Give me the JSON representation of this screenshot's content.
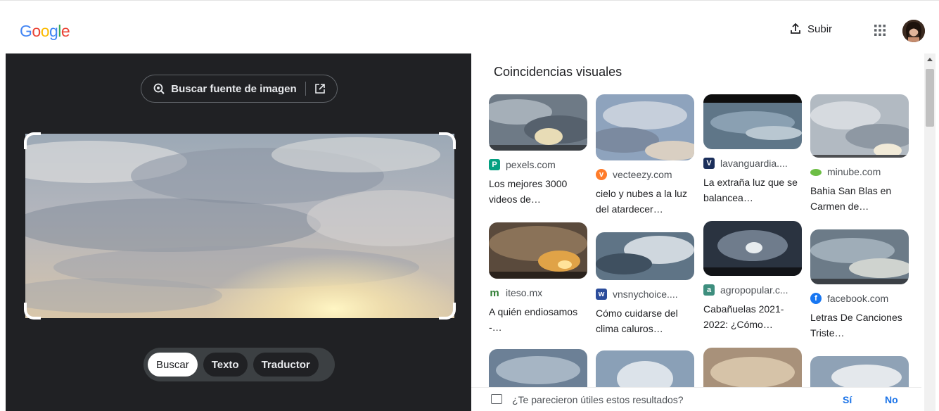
{
  "header": {
    "logo_letters": [
      "G",
      "o",
      "o",
      "g",
      "l",
      "e"
    ],
    "logo_colors": [
      "#4285F4",
      "#EA4335",
      "#FBBC05",
      "#4285F4",
      "#34A853",
      "#EA4335"
    ],
    "upload_label": "Subir",
    "upload_icon": "upload-icon",
    "apps_icon": "apps-grid-icon"
  },
  "left_panel": {
    "source_button_label": "Buscar fuente de imagen",
    "source_icon": "lens-search-icon",
    "open_icon": "open-in-new-icon",
    "modes": [
      {
        "label": "Buscar",
        "active": true
      },
      {
        "label": "Texto",
        "active": false
      },
      {
        "label": "Traductor",
        "active": false
      }
    ]
  },
  "results": {
    "title": "Coincidencias visuales",
    "cards": [
      {
        "site": "pexels.com",
        "favicon_letter": "P",
        "favicon_color": "#05A081",
        "title": "Los mejores 3000 videos de…"
      },
      {
        "site": "vecteezy.com",
        "favicon_letter": "v",
        "favicon_color": "#FF7C2A",
        "title": "cielo y nubes a la luz del atardecer…"
      },
      {
        "site": "lavanguardia....",
        "favicon_letter": "V",
        "favicon_color": "#1A2E5A",
        "title": "La extraña luz que se balancea…"
      },
      {
        "site": "minube.com",
        "favicon_letter": "",
        "favicon_color": "#6DBE45",
        "title": "Bahia San Blas en Carmen de…"
      },
      {
        "site": "iteso.mx",
        "favicon_letter": "m",
        "favicon_color": "#2E7D32",
        "title": "A quién endiosamos -…"
      },
      {
        "site": "vnsnychoice....",
        "favicon_letter": "w",
        "favicon_color": "#2B4C9B",
        "title": "Cómo cuidarse del clima caluros…"
      },
      {
        "site": "agropopular.c...",
        "favicon_letter": "a",
        "favicon_color": "#3E8E7E",
        "title": "Cabañuelas 2021-2022: ¿Cómo…"
      },
      {
        "site": "facebook.com",
        "favicon_letter": "f",
        "favicon_color": "#1877F2",
        "title": "Letras De Canciones Triste…"
      }
    ]
  },
  "feedback": {
    "question": "¿Te parecieron útiles estos resultados?",
    "yes": "Sí",
    "no": "No"
  }
}
